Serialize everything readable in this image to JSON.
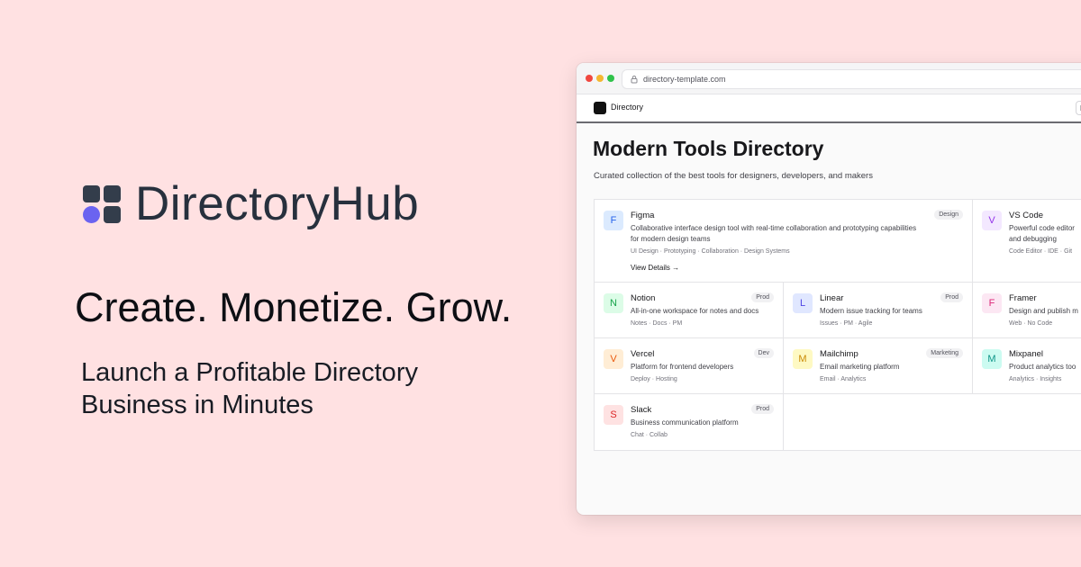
{
  "hero": {
    "brand": "DirectoryHub",
    "tagline": "Create. Monetize. Grow.",
    "subtagline": "Launch a Profitable Directory Business in Minutes",
    "accent_color": "#6b63f0",
    "background_color": "#ffe1e2"
  },
  "browser": {
    "url": "directory-template.com",
    "icons": [
      "lock-icon"
    ],
    "nav": {
      "app_name": "Directory",
      "button_label": "E"
    },
    "page": {
      "title": "Modern Tools Directory",
      "description": "Curated collection of the best tools for designers, developers, and makers"
    },
    "tools": [
      {
        "initial": "F",
        "name": "Figma",
        "badge": "Design",
        "desc_line1": "Collaborative interface design tool with real-time collaboration and prototyping capabilities",
        "desc_line2": "for modern design teams",
        "tags": "UI Design · Prototyping · Collaboration · Design Systems",
        "link": "View Details →",
        "bg": "#dbeafe",
        "fg": "#2563eb"
      },
      {
        "initial": "V",
        "name": "VS Code",
        "badge": "",
        "desc_line1": "Powerful code editor",
        "desc_line2": "and debugging",
        "tags": "Code Editor · IDE · Git",
        "bg": "#f3e8ff",
        "fg": "#9333ea"
      },
      {
        "initial": "N",
        "name": "Notion",
        "badge": "Prod",
        "desc_line1": "All-in-one workspace for notes and docs",
        "tags": "Notes · Docs · PM",
        "bg": "#dcfce7",
        "fg": "#16a34a"
      },
      {
        "initial": "L",
        "name": "Linear",
        "badge": "Prod",
        "desc_line1": "Modern issue tracking for teams",
        "tags": "Issues · PM · Agile",
        "bg": "#e0e7ff",
        "fg": "#4f46e5"
      },
      {
        "initial": "F",
        "name": "Framer",
        "badge": "",
        "desc_line1": "Design and publish m",
        "tags": "Web · No Code",
        "bg": "#fce7f3",
        "fg": "#db2777"
      },
      {
        "initial": "V",
        "name": "Vercel",
        "badge": "Dev",
        "desc_line1": "Platform for frontend developers",
        "tags": "Deploy · Hosting",
        "bg": "#ffedd5",
        "fg": "#ea580c"
      },
      {
        "initial": "M",
        "name": "Mailchimp",
        "badge": "Marketing",
        "desc_line1": "Email marketing platform",
        "tags": "Email · Analytics",
        "bg": "#fef9c3",
        "fg": "#ca8a04"
      },
      {
        "initial": "M",
        "name": "Mixpanel",
        "badge": "",
        "desc_line1": "Product analytics too",
        "tags": "Analytics · Insights",
        "bg": "#ccfbf1",
        "fg": "#0d9488"
      },
      {
        "initial": "S",
        "name": "Slack",
        "badge": "Prod",
        "desc_line1": "Business communication platform",
        "tags": "Chat · Collab",
        "bg": "#fee2e2",
        "fg": "#dc2626"
      }
    ]
  }
}
